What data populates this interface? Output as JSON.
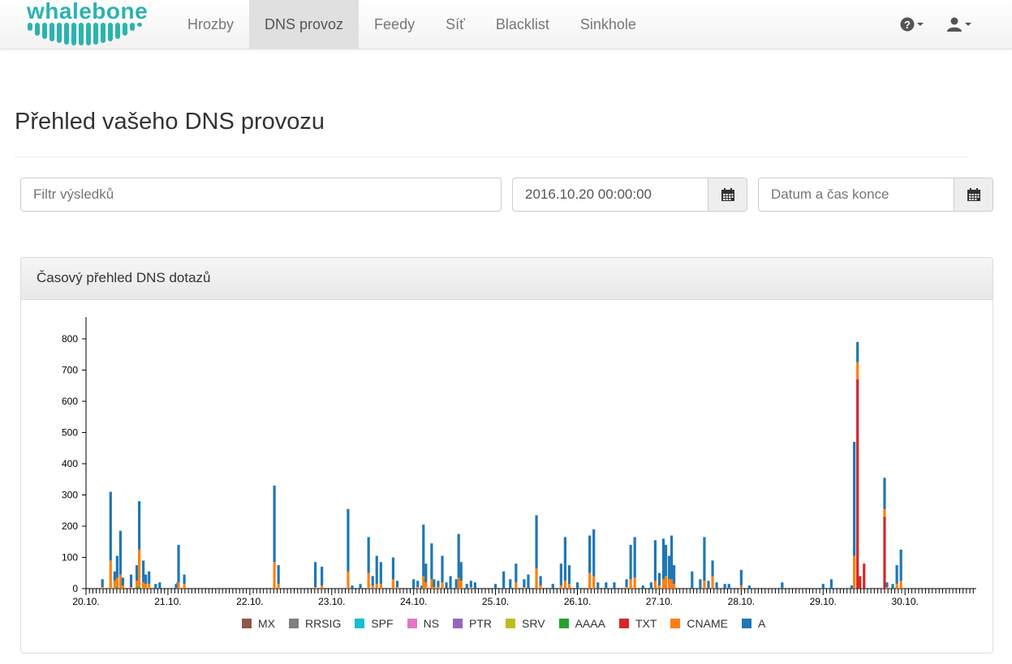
{
  "brand": {
    "name": "whalebone",
    "color": "#2bb3b0"
  },
  "nav": {
    "items": [
      {
        "label": "Hrozby",
        "active": false
      },
      {
        "label": "DNS provoz",
        "active": true
      },
      {
        "label": "Feedy",
        "active": false
      },
      {
        "label": "Síť",
        "active": false
      },
      {
        "label": "Blacklist",
        "active": false
      },
      {
        "label": "Sinkhole",
        "active": false
      }
    ],
    "right_icons": [
      "help-icon",
      "user-icon"
    ]
  },
  "page": {
    "title": "Přehled vašeho DNS provozu"
  },
  "filters": {
    "search_placeholder": "Filtr výsledků",
    "start_value": "2016.10.20 00:00:00",
    "end_placeholder": "Datum a čas konce",
    "calendar_icon": "calendar-icon"
  },
  "panel": {
    "title": "Časový přehled DNS dotazů"
  },
  "chart_data": {
    "type": "bar",
    "stacked": true,
    "title": "",
    "xlabel": "",
    "ylabel": "",
    "ylim": [
      0,
      870
    ],
    "yticks": [
      0,
      100,
      200,
      300,
      400,
      500,
      600,
      700,
      800
    ],
    "xticks": [
      "20.10.",
      "21.10.",
      "22.10.",
      "23.10.",
      "24.10.",
      "25.10.",
      "26.10.",
      "27.10.",
      "28.10.",
      "29.10.",
      "30.10."
    ],
    "legend": [
      "MX",
      "RRSIG",
      "SPF",
      "NS",
      "PTR",
      "SRV",
      "AAAA",
      "TXT",
      "CNAME",
      "A"
    ],
    "legend_position": "bottom",
    "colors": {
      "MX": "#8c564b",
      "RRSIG": "#7f7f7f",
      "SPF": "#17becf",
      "NS": "#e377c2",
      "PTR": "#9467bd",
      "SRV": "#bcbd22",
      "AAAA": "#2ca02c",
      "TXT": "#d62728",
      "CNAME": "#ff7f0e",
      "A": "#1f77b4"
    },
    "bars": [
      {
        "t": 20.2,
        "A": 25,
        "CNAME": 5
      },
      {
        "t": 20.3,
        "A": 220,
        "CNAME": 90
      },
      {
        "t": 20.35,
        "A": 30,
        "CNAME": 25
      },
      {
        "t": 20.38,
        "A": 70,
        "CNAME": 30,
        "AAAA": 5
      },
      {
        "t": 20.42,
        "A": 140,
        "CNAME": 45
      },
      {
        "t": 20.45,
        "A": 25,
        "CNAME": 10
      },
      {
        "t": 20.55,
        "A": 40,
        "CNAME": 5
      },
      {
        "t": 20.62,
        "A": 50,
        "CNAME": 20,
        "AAAA": 5
      },
      {
        "t": 20.65,
        "A": 155,
        "CNAME": 120,
        "AAAA": 5
      },
      {
        "t": 20.7,
        "A": 70,
        "CNAME": 20
      },
      {
        "t": 20.73,
        "A": 30,
        "CNAME": 15
      },
      {
        "t": 20.77,
        "A": 40,
        "CNAME": 15
      },
      {
        "t": 20.85,
        "A": 15
      },
      {
        "t": 20.9,
        "A": 20
      },
      {
        "t": 21.1,
        "A": 15
      },
      {
        "t": 21.12,
        "A": 20
      },
      {
        "t": 21.13,
        "A": 120,
        "CNAME": 20
      },
      {
        "t": 21.2,
        "A": 30,
        "CNAME": 15
      },
      {
        "t": 22.3,
        "A": 245,
        "CNAME": 85
      },
      {
        "t": 22.35,
        "A": 60,
        "CNAME": 15
      },
      {
        "t": 22.8,
        "A": 80,
        "CNAME": 5
      },
      {
        "t": 22.88,
        "A": 60,
        "CNAME": 10
      },
      {
        "t": 23.2,
        "A": 200,
        "CNAME": 55
      },
      {
        "t": 23.25,
        "A": 10
      },
      {
        "t": 23.35,
        "A": 15
      },
      {
        "t": 23.45,
        "A": 115,
        "CNAME": 50
      },
      {
        "t": 23.5,
        "A": 30,
        "CNAME": 10
      },
      {
        "t": 23.55,
        "A": 90,
        "CNAME": 15
      },
      {
        "t": 23.6,
        "A": 70,
        "CNAME": 15
      },
      {
        "t": 23.75,
        "A": 70,
        "CNAME": 30
      },
      {
        "t": 23.8,
        "A": 20,
        "CNAME": 5
      },
      {
        "t": 24.0,
        "A": 30
      },
      {
        "t": 24.05,
        "A": 20,
        "CNAME": 5
      },
      {
        "t": 24.1,
        "A": 10
      },
      {
        "t": 24.12,
        "A": 165,
        "CNAME": 40
      },
      {
        "t": 24.15,
        "A": 60,
        "CNAME": 20
      },
      {
        "t": 24.22,
        "A": 115,
        "CNAME": 30
      },
      {
        "t": 24.25,
        "A": 25,
        "CNAME": 5
      },
      {
        "t": 24.3,
        "A": 20,
        "CNAME": 5
      },
      {
        "t": 24.35,
        "A": 85,
        "CNAME": 20
      },
      {
        "t": 24.4,
        "A": 20
      },
      {
        "t": 24.45,
        "A": 40
      },
      {
        "t": 24.52,
        "A": 30
      },
      {
        "t": 24.55,
        "A": 140,
        "CNAME": 35
      },
      {
        "t": 24.58,
        "A": 60,
        "CNAME": 25
      },
      {
        "t": 24.65,
        "A": 15
      },
      {
        "t": 24.7,
        "A": 20,
        "CNAME": 5
      },
      {
        "t": 24.75,
        "A": 20
      },
      {
        "t": 25.0,
        "A": 15
      },
      {
        "t": 25.1,
        "A": 55
      },
      {
        "t": 25.18,
        "A": 30
      },
      {
        "t": 25.25,
        "A": 60,
        "CNAME": 20
      },
      {
        "t": 25.35,
        "A": 25,
        "CNAME": 5
      },
      {
        "t": 25.4,
        "A": 45
      },
      {
        "t": 25.5,
        "A": 170,
        "CNAME": 65
      },
      {
        "t": 25.55,
        "A": 30,
        "CNAME": 10
      },
      {
        "t": 25.7,
        "A": 15
      },
      {
        "t": 25.8,
        "A": 70,
        "CNAME": 10
      },
      {
        "t": 25.85,
        "A": 140,
        "CNAME": 25
      },
      {
        "t": 25.9,
        "A": 60,
        "CNAME": 15
      },
      {
        "t": 26.0,
        "A": 20
      },
      {
        "t": 26.15,
        "A": 120,
        "CNAME": 50
      },
      {
        "t": 26.2,
        "A": 150,
        "CNAME": 40
      },
      {
        "t": 26.25,
        "A": 20
      },
      {
        "t": 26.35,
        "A": 20
      },
      {
        "t": 26.45,
        "A": 20
      },
      {
        "t": 26.6,
        "A": 25,
        "CNAME": 5
      },
      {
        "t": 26.65,
        "A": 110,
        "CNAME": 30
      },
      {
        "t": 26.7,
        "A": 130,
        "CNAME": 35
      },
      {
        "t": 26.8,
        "A": 10
      },
      {
        "t": 26.9,
        "A": 20
      },
      {
        "t": 26.95,
        "A": 130,
        "CNAME": 25
      },
      {
        "t": 27.0,
        "A": 40,
        "CNAME": 10
      },
      {
        "t": 27.05,
        "A": 130,
        "CNAME": 30
      },
      {
        "t": 27.08,
        "A": 100,
        "CNAME": 40
      },
      {
        "t": 27.12,
        "A": 75,
        "CNAME": 30
      },
      {
        "t": 27.15,
        "A": 140,
        "CNAME": 30
      },
      {
        "t": 27.18,
        "A": 60,
        "CNAME": 15
      },
      {
        "t": 27.4,
        "A": 55
      },
      {
        "t": 27.5,
        "A": 30
      },
      {
        "t": 27.55,
        "A": 140,
        "CNAME": 25
      },
      {
        "t": 27.6,
        "A": 25
      },
      {
        "t": 27.65,
        "A": 50,
        "CNAME": 40
      },
      {
        "t": 27.7,
        "A": 20
      },
      {
        "t": 27.8,
        "A": 15
      },
      {
        "t": 27.85,
        "A": 15
      },
      {
        "t": 28.0,
        "A": 50,
        "CNAME": 10
      },
      {
        "t": 28.1,
        "A": 10
      },
      {
        "t": 28.5,
        "A": 20
      },
      {
        "t": 29.0,
        "A": 15
      },
      {
        "t": 29.1,
        "A": 30
      },
      {
        "t": 29.35,
        "A": 10
      },
      {
        "t": 29.38,
        "A": 365,
        "CNAME": 105
      },
      {
        "t": 29.42,
        "A": 65,
        "CNAME": 55,
        "TXT": 670
      },
      {
        "t": 29.45,
        "TXT": 40
      },
      {
        "t": 29.5,
        "TXT": 80
      },
      {
        "t": 29.75,
        "A": 100,
        "CNAME": 25,
        "TXT": 230
      },
      {
        "t": 29.78,
        "A": 15,
        "CNAME": 5
      },
      {
        "t": 29.85,
        "A": 15
      },
      {
        "t": 29.9,
        "A": 60,
        "CNAME": 15
      },
      {
        "t": 29.95,
        "A": 100,
        "CNAME": 25
      }
    ]
  }
}
